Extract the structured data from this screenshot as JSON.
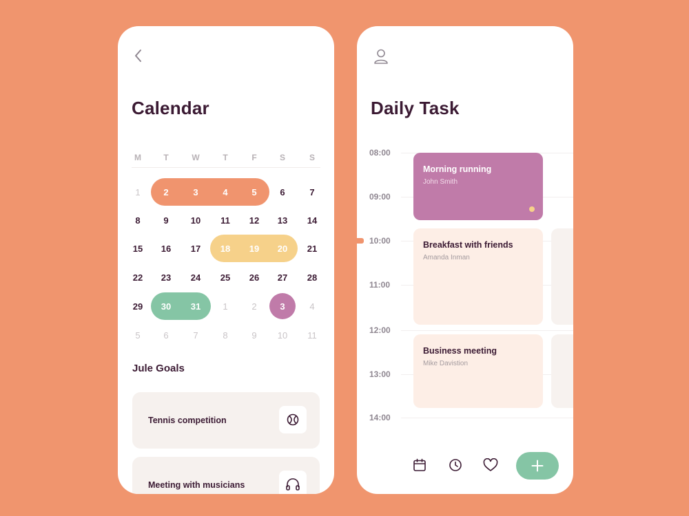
{
  "calendar_screen": {
    "title": "Calendar",
    "weekdays": [
      "M",
      "T",
      "W",
      "T",
      "F",
      "S",
      "S"
    ],
    "weeks": [
      [
        {
          "d": "1",
          "state": "muted"
        },
        {
          "d": "2",
          "state": "on"
        },
        {
          "d": "3",
          "state": "on"
        },
        {
          "d": "4",
          "state": "on"
        },
        {
          "d": "5",
          "state": "on"
        },
        {
          "d": "6",
          "state": "normal"
        },
        {
          "d": "7",
          "state": "normal"
        }
      ],
      [
        {
          "d": "8",
          "state": "normal"
        },
        {
          "d": "9",
          "state": "normal"
        },
        {
          "d": "10",
          "state": "normal"
        },
        {
          "d": "11",
          "state": "normal"
        },
        {
          "d": "12",
          "state": "normal"
        },
        {
          "d": "13",
          "state": "normal"
        },
        {
          "d": "14",
          "state": "normal"
        }
      ],
      [
        {
          "d": "15",
          "state": "normal"
        },
        {
          "d": "16",
          "state": "normal"
        },
        {
          "d": "17",
          "state": "normal"
        },
        {
          "d": "18",
          "state": "on"
        },
        {
          "d": "19",
          "state": "on"
        },
        {
          "d": "20",
          "state": "on"
        },
        {
          "d": "21",
          "state": "normal"
        }
      ],
      [
        {
          "d": "22",
          "state": "normal"
        },
        {
          "d": "23",
          "state": "normal"
        },
        {
          "d": "24",
          "state": "normal"
        },
        {
          "d": "25",
          "state": "normal"
        },
        {
          "d": "26",
          "state": "normal"
        },
        {
          "d": "27",
          "state": "normal"
        },
        {
          "d": "28",
          "state": "normal"
        }
      ],
      [
        {
          "d": "29",
          "state": "normal"
        },
        {
          "d": "30",
          "state": "on"
        },
        {
          "d": "31",
          "state": "on"
        },
        {
          "d": "1",
          "state": "muted"
        },
        {
          "d": "2",
          "state": "muted"
        },
        {
          "d": "3",
          "state": "on"
        },
        {
          "d": "4",
          "state": "muted"
        }
      ],
      [
        {
          "d": "5",
          "state": "muted"
        },
        {
          "d": "6",
          "state": "muted"
        },
        {
          "d": "7",
          "state": "muted"
        },
        {
          "d": "8",
          "state": "muted"
        },
        {
          "d": "9",
          "state": "muted"
        },
        {
          "d": "10",
          "state": "muted"
        },
        {
          "d": "11",
          "state": "muted"
        }
      ]
    ],
    "highlights": [
      {
        "color": "orange",
        "week": 0,
        "from": 1,
        "to": 4
      },
      {
        "color": "yellow",
        "week": 2,
        "from": 3,
        "to": 5
      },
      {
        "color": "green",
        "week": 4,
        "from": 1,
        "to": 2
      },
      {
        "color": "purple",
        "week": 4,
        "from": 5,
        "to": 5
      }
    ],
    "goals_title": "Jule Goals",
    "goals": [
      {
        "label": "Tennis competition",
        "icon": "tennis-ball-icon"
      },
      {
        "label": "Meeting with musicians",
        "icon": "headphones-icon"
      }
    ]
  },
  "daily_task_screen": {
    "title": "Daily Task",
    "times": [
      "08:00",
      "09:00",
      "10:00",
      "11:00",
      "12:00",
      "13:00",
      "14:00"
    ],
    "tasks": [
      {
        "title": "Morning running",
        "person": "John Smith",
        "style": "purple"
      },
      {
        "title": "Breakfast with friends",
        "person": "Amanda Inman",
        "style": "peach"
      },
      {
        "title": "Business meeting",
        "person": "Mike Davistion",
        "style": "peach"
      }
    ],
    "nav": [
      {
        "name": "calendar-nav-button",
        "icon": "calendar-icon"
      },
      {
        "name": "clock-nav-button",
        "icon": "clock-icon"
      },
      {
        "name": "favorites-nav-button",
        "icon": "heart-icon"
      }
    ],
    "add_icon": "plus-icon"
  },
  "colors": {
    "background": "#F0956E",
    "orange": "#F0946E",
    "yellow": "#F6D18A",
    "green": "#85C5A5",
    "purple": "#C07BA9",
    "peach": "#FDEEE6",
    "dark_text": "#3B1A33"
  }
}
